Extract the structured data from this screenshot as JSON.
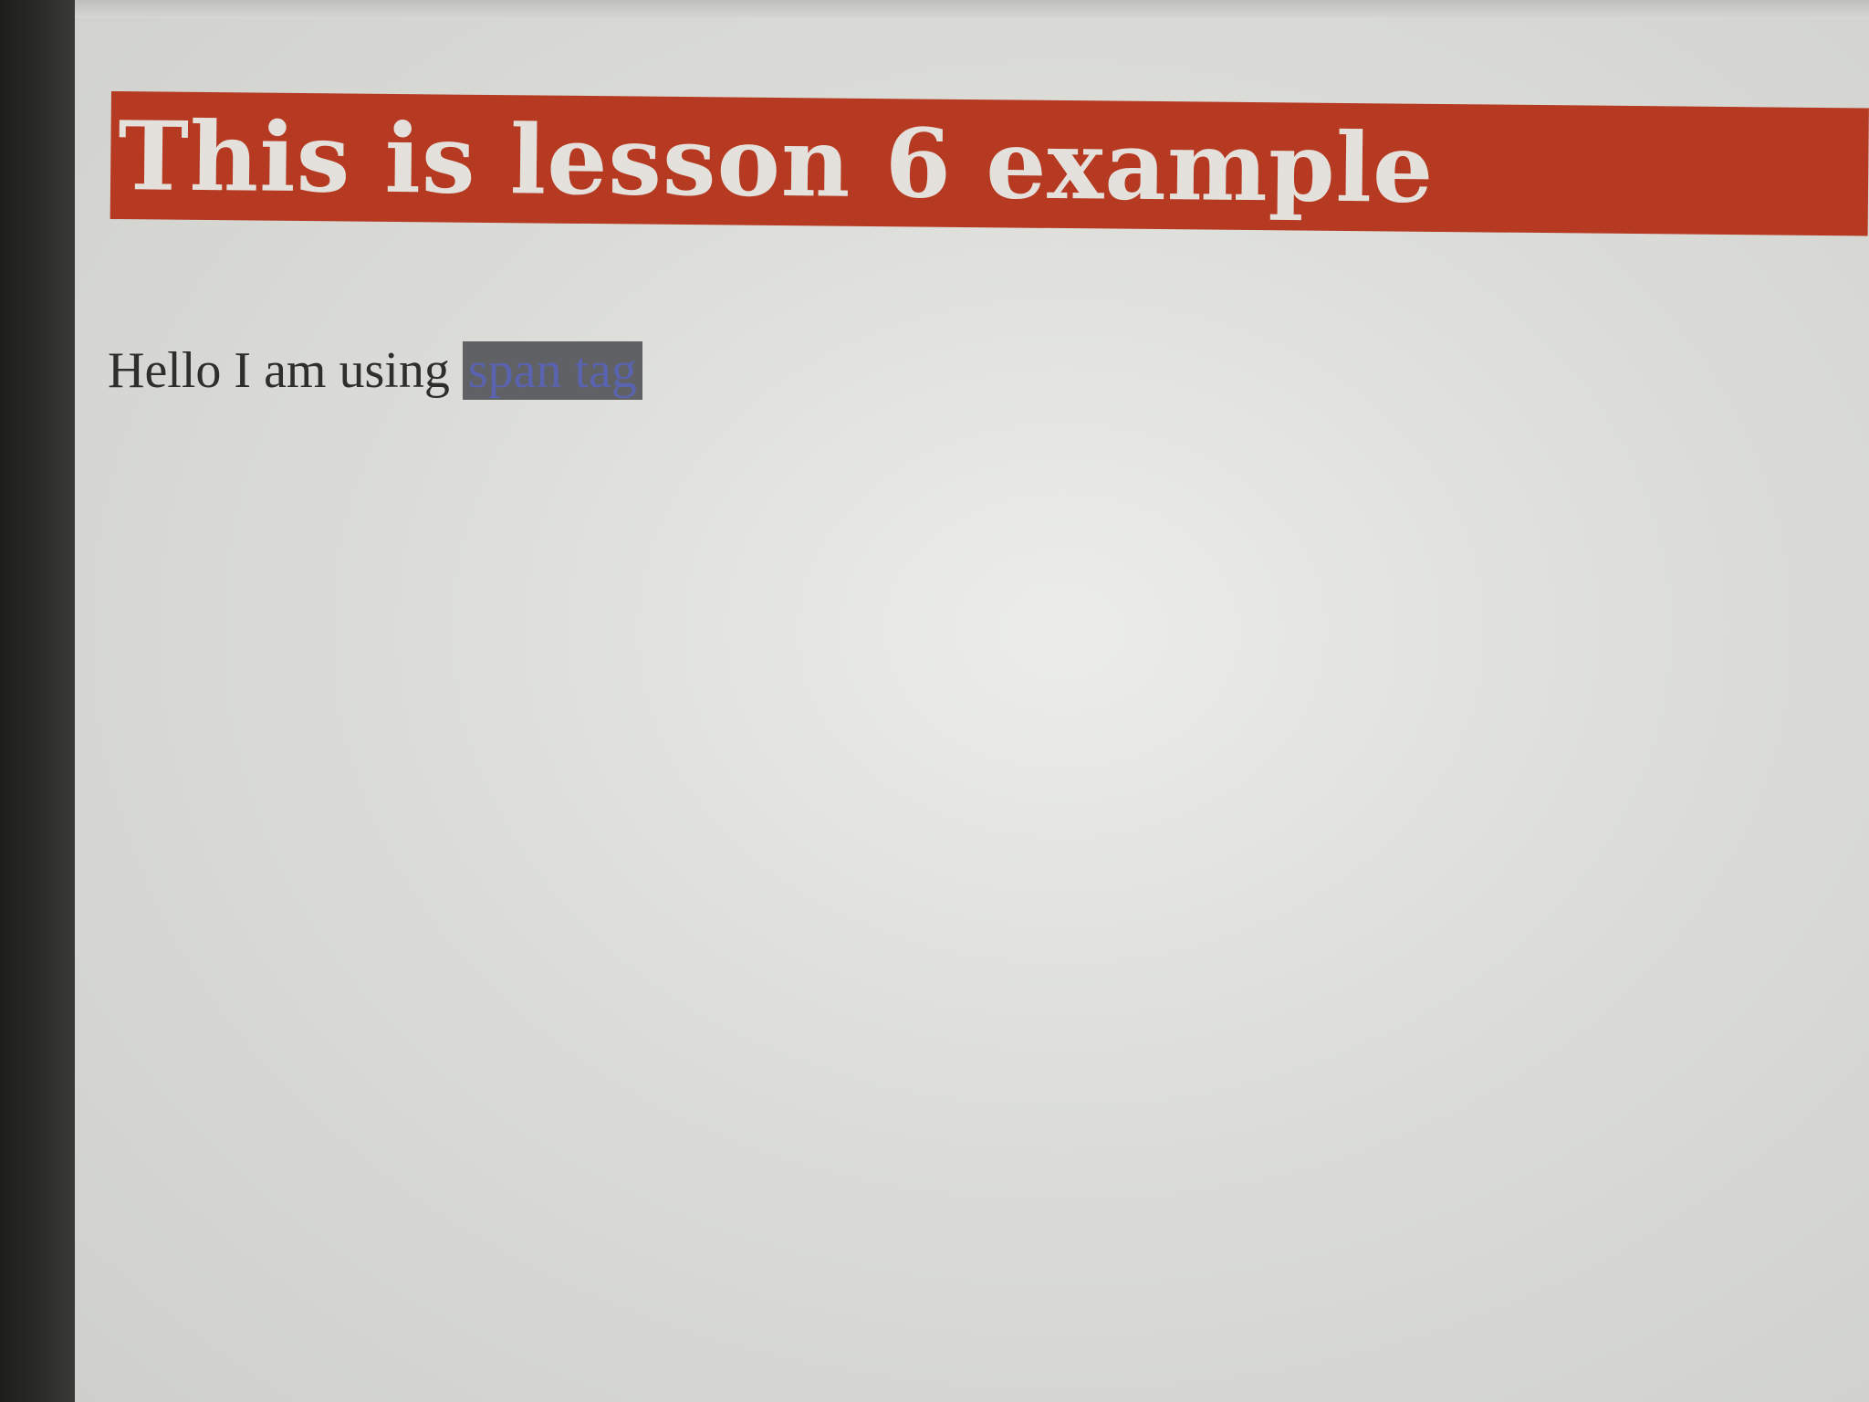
{
  "page": {
    "heading": "This is lesson 6 example",
    "paragraph_text": "Hello I am using",
    "span_text": "span tag"
  },
  "colors": {
    "heading_background": "#b63a22",
    "heading_text": "#e4e1dc",
    "span_background": "#606164",
    "span_text": "#5a63b0"
  }
}
